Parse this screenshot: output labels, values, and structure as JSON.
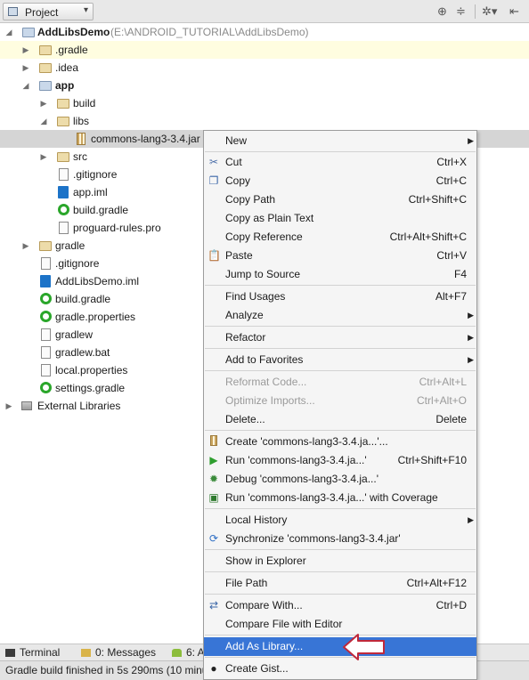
{
  "header": {
    "project_label": "Project",
    "icons": [
      "target-icon",
      "collapse-icon",
      "gear-icon",
      "hide-panel-icon"
    ]
  },
  "tree": [
    {
      "label": "AddLibsDemo",
      "path": "(E:\\ANDROID_TUTORIAL\\AddLibsDemo)",
      "icon": "module-folder-icon",
      "expanded": true,
      "bold": true
    },
    {
      "label": ".gradle",
      "icon": "folder-icon",
      "expanded": false
    },
    {
      "label": ".idea",
      "icon": "folder-icon",
      "expanded": false
    },
    {
      "label": "app",
      "icon": "module-folder-icon",
      "expanded": true,
      "bold": true
    },
    {
      "label": "build",
      "icon": "folder-icon",
      "expanded": false
    },
    {
      "label": "libs",
      "icon": "folder-icon",
      "expanded": true
    },
    {
      "label": "commons-lang3-3.4.jar",
      "icon": "jar-icon",
      "selected": true
    },
    {
      "label": "src",
      "icon": "folder-icon",
      "expanded": false
    },
    {
      "label": ".gitignore",
      "icon": "file-icon"
    },
    {
      "label": "app.iml",
      "icon": "iml-icon"
    },
    {
      "label": "build.gradle",
      "icon": "gradle-icon"
    },
    {
      "label": "proguard-rules.pro",
      "icon": "file-icon"
    },
    {
      "label": "gradle",
      "icon": "folder-icon",
      "expanded": false
    },
    {
      "label": ".gitignore",
      "icon": "file-icon"
    },
    {
      "label": "AddLibsDemo.iml",
      "icon": "iml-icon"
    },
    {
      "label": "build.gradle",
      "icon": "gradle-icon"
    },
    {
      "label": "gradle.properties",
      "icon": "gradle-icon"
    },
    {
      "label": "gradlew",
      "icon": "file-icon"
    },
    {
      "label": "gradlew.bat",
      "icon": "file-icon"
    },
    {
      "label": "local.properties",
      "icon": "file-icon"
    },
    {
      "label": "settings.gradle",
      "icon": "gradle-icon"
    },
    {
      "label": "External Libraries",
      "icon": "library-icon",
      "expanded": false
    }
  ],
  "menu": [
    {
      "label": "New",
      "submenu": true
    },
    {
      "label": "Cut",
      "shortcut": "Ctrl+X",
      "icon": "scissors-icon"
    },
    {
      "label": "Copy",
      "shortcut": "Ctrl+C",
      "icon": "copy-icon"
    },
    {
      "label": "Copy Path",
      "shortcut": "Ctrl+Shift+C"
    },
    {
      "label": "Copy as Plain Text"
    },
    {
      "label": "Copy Reference",
      "shortcut": "Ctrl+Alt+Shift+C"
    },
    {
      "label": "Paste",
      "shortcut": "Ctrl+V",
      "icon": "paste-icon"
    },
    {
      "label": "Jump to Source",
      "shortcut": "F4"
    },
    {
      "label": "Find Usages",
      "shortcut": "Alt+F7"
    },
    {
      "label": "Analyze",
      "submenu": true
    },
    {
      "label": "Refactor",
      "submenu": true
    },
    {
      "label": "Add to Favorites",
      "submenu": true
    },
    {
      "label": "Reformat Code...",
      "shortcut": "Ctrl+Alt+L",
      "disabled": true
    },
    {
      "label": "Optimize Imports...",
      "shortcut": "Ctrl+Alt+O",
      "disabled": true
    },
    {
      "label": "Delete...",
      "shortcut": "Delete"
    },
    {
      "label": "Create 'commons-lang3-3.4.ja...'...",
      "icon": "jar-icon"
    },
    {
      "label": "Run 'commons-lang3-3.4.ja...'",
      "shortcut": "Ctrl+Shift+F10",
      "icon": "run-icon"
    },
    {
      "label": "Debug 'commons-lang3-3.4.ja...'",
      "icon": "debug-icon"
    },
    {
      "label": "Run 'commons-lang3-3.4.ja...' with Coverage",
      "icon": "coverage-icon"
    },
    {
      "label": "Local History",
      "submenu": true
    },
    {
      "label": "Synchronize 'commons-lang3-3.4.jar'",
      "icon": "sync-icon"
    },
    {
      "label": "Show in Explorer"
    },
    {
      "label": "File Path",
      "shortcut": "Ctrl+Alt+F12"
    },
    {
      "label": "Compare With...",
      "shortcut": "Ctrl+D",
      "icon": "compare-icon"
    },
    {
      "label": "Compare File with Editor"
    },
    {
      "label": "Add As Library...",
      "selected": true
    },
    {
      "label": "Create Gist...",
      "icon": "github-icon"
    }
  ],
  "toolwindows": [
    {
      "label": "Terminal",
      "icon": "terminal-icon"
    },
    {
      "label": "0: Messages",
      "icon": "messages-icon"
    },
    {
      "label": "6: A",
      "icon": "android-icon"
    }
  ],
  "status": {
    "text": "Gradle build finished in 5s 290ms (10 minu"
  },
  "colors": {
    "selection": "#3875d6",
    "selected_row": "#d5d5d5",
    "current_row": "#fffde0",
    "folder": "#eddcaa",
    "gradle": "#2aa62a"
  }
}
